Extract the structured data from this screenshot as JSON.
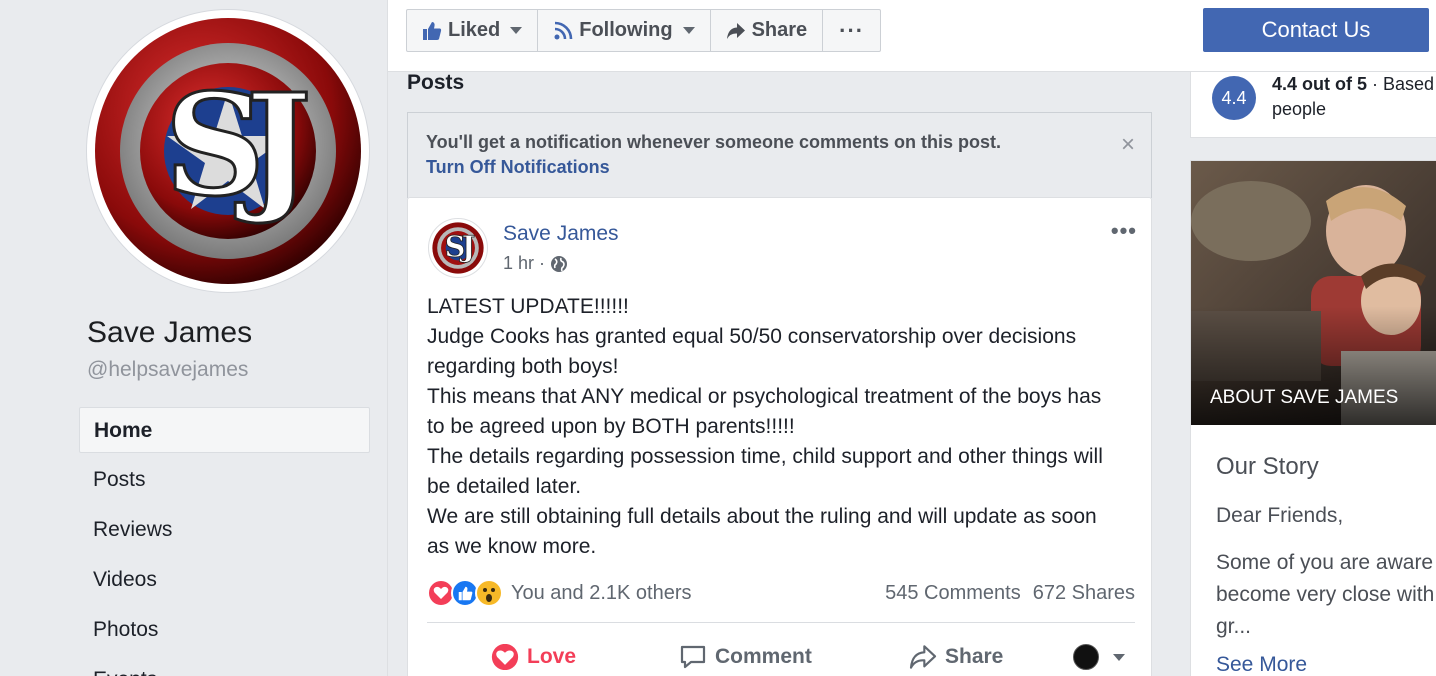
{
  "page": {
    "name": "Save James",
    "handle": "@helpsavejames"
  },
  "nav": [
    {
      "label": "Home",
      "active": true
    },
    {
      "label": "Posts"
    },
    {
      "label": "Reviews"
    },
    {
      "label": "Videos"
    },
    {
      "label": "Photos"
    },
    {
      "label": "Events"
    }
  ],
  "toolbar": {
    "liked": "Liked",
    "following": "Following",
    "share": "Share",
    "more": "···",
    "contact": "Contact Us"
  },
  "section_title": "Posts",
  "notification": {
    "text": "You'll get a notification whenever someone comments on this post.",
    "link": "Turn Off Notifications",
    "close": "×"
  },
  "post": {
    "author": "Save James",
    "time": "1 hr ·",
    "more": "•••",
    "lines": [
      "LATEST UPDATE!!!!!!",
      "Judge Cooks has granted equal 50/50 conservatorship over decisions",
      "regarding both boys!",
      "This means that ANY medical or psychological treatment of the boys has",
      "to be agreed upon by BOTH parents!!!!!",
      "The details regarding possession time, child support and other things will",
      "be detailed later.",
      "We are still obtaining full details about the ruling and will update as soon",
      "as we know more."
    ],
    "reactions_text": "You and 2.1K others",
    "comments": "545 Comments",
    "shares": "672 Shares",
    "actions": {
      "love": "Love",
      "comment": "Comment",
      "share": "Share"
    }
  },
  "rating": {
    "score": "4.4",
    "line1_bold": "4.4 out of 5",
    "line1_rest": " · Based",
    "line2": "people"
  },
  "about": {
    "label": "ABOUT SAVE JAMES",
    "heading": "Our Story",
    "p1": "Dear Friends,",
    "p2_lines": [
      "Some of you are aware",
      "become very close with",
      "gr..."
    ],
    "see_more": "See More"
  },
  "colors": {
    "brand": "#4267b2",
    "link": "#365899",
    "love": "#f33e58"
  },
  "icons": [
    "thumbs-up-icon",
    "rss-icon",
    "share-arrow-icon",
    "globe-icon",
    "heart-icon",
    "comment-icon",
    "chevron-down-icon"
  ]
}
